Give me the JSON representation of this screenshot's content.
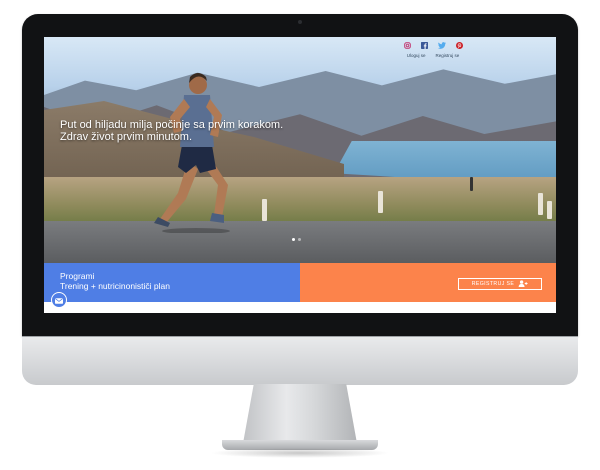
{
  "header": {
    "social": [
      {
        "icon": "instagram-icon",
        "color": "#c2336d"
      },
      {
        "icon": "facebook-icon",
        "color": "#3b5998"
      },
      {
        "icon": "twitter-icon",
        "color": "#55acee"
      },
      {
        "icon": "pinterest-icon",
        "color": "#cb2027"
      }
    ],
    "login_label": "Uloguj se",
    "register_label": "Registruj se"
  },
  "hero": {
    "line1": "Put od hiljadu milja počinje sa prvim korakom.",
    "line2": "Zdrav život prvim minutom.",
    "slide_count": 2,
    "active_slide": 1
  },
  "programs": {
    "title": "Programi",
    "subtitle": "Trening + nutricinonističi plan",
    "color": "#4f7ee5"
  },
  "register": {
    "button_label": "REGISTRUJ SE",
    "icon": "user-add-icon",
    "color": "#fc834b"
  },
  "chat": {
    "icon": "envelope-icon"
  }
}
